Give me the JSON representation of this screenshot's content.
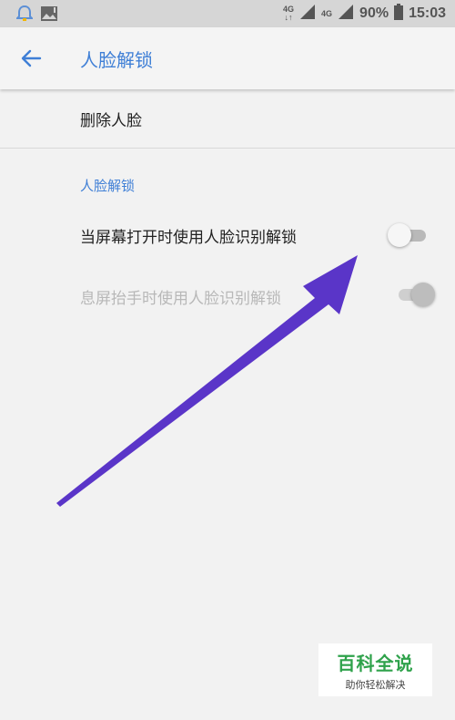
{
  "status_bar": {
    "network_label_1": "4G",
    "network_label_2": "4G",
    "battery": "90%",
    "time": "15:03",
    "icons": [
      "notification-bell-icon",
      "image-notification-icon",
      "signal-icon",
      "signal-icon",
      "battery-icon"
    ]
  },
  "toolbar": {
    "title": "人脸解锁",
    "back_icon": "back-arrow-icon"
  },
  "rows": {
    "delete_face": "删除人脸"
  },
  "section": {
    "header": "人脸解锁",
    "items": [
      {
        "label": "当屏幕打开时使用人脸识别解锁",
        "enabled": true,
        "checked": false
      },
      {
        "label": "息屏抬手时使用人脸识别解锁",
        "enabled": false,
        "checked": true
      }
    ]
  },
  "annotation": {
    "color": "#5a35c8"
  },
  "watermark": {
    "title": "百科全说",
    "subtitle": "助你轻松解决"
  },
  "colors": {
    "accent": "#3f7fd6",
    "background": "#f2f2f2",
    "watermark_green": "#2fa24b"
  }
}
